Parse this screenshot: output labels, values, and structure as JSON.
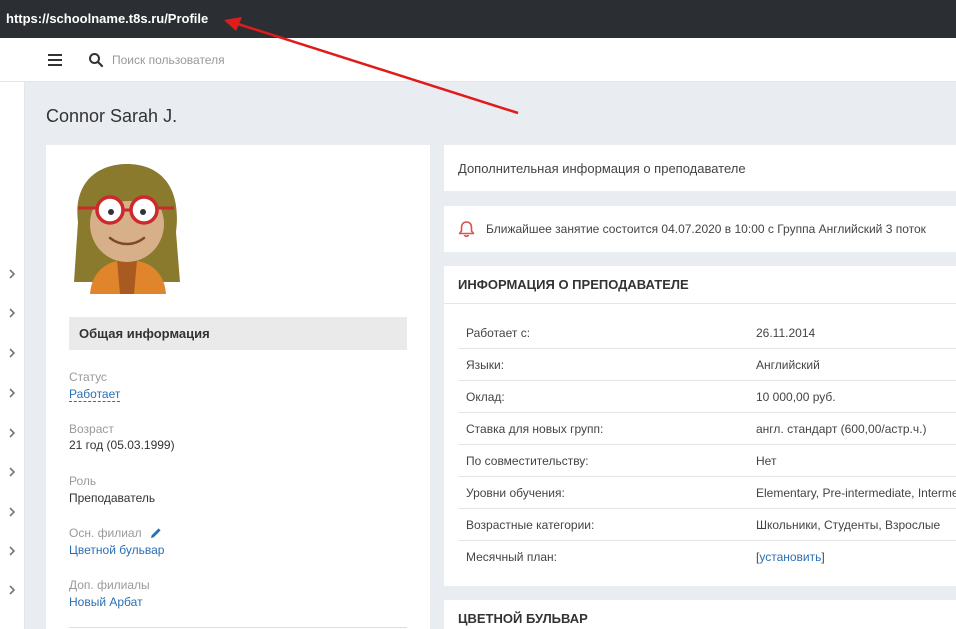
{
  "browser": {
    "url": "https://schoolname.t8s.ru/Profile"
  },
  "topbar": {
    "search_placeholder": "Поиск пользователя"
  },
  "sidebar": {
    "items": 9
  },
  "page": {
    "title": "Connor Sarah J."
  },
  "profile": {
    "section_title": "Общая информация",
    "fields": {
      "status_label": "Статус",
      "status_value": "Работает",
      "age_label": "Возраст",
      "age_value": "21 год (05.03.1999)",
      "role_label": "Роль",
      "role_value": "Преподаватель",
      "branch_label": "Осн. филиал",
      "branch_value": "Цветной бульвар",
      "extra_branches_label": "Доп. филиалы",
      "extra_branches_value": "Новый Арбат"
    }
  },
  "extra_info": {
    "label": "Дополнительная информация о преподавателе"
  },
  "notice": {
    "text": "Ближайшее занятие состоится 04.07.2020 в 10:00 с Группа Английский 3 поток"
  },
  "teacher_info": {
    "title": "ИНФОРМАЦИЯ О ПРЕПОДАВАТЕЛЕ",
    "rows": [
      {
        "key": "Работает с:",
        "value": "26.11.2014"
      },
      {
        "key": "Языки:",
        "value": "Английский"
      },
      {
        "key": "Оклад:",
        "value": "10 000,00 руб."
      },
      {
        "key": "Ставка для новых групп:",
        "value": "англ. стандарт (600,00/астр.ч.)"
      },
      {
        "key": "По совместительству:",
        "value": "Нет"
      },
      {
        "key": "Уровни обучения:",
        "value": "Elementary, Pre-intermediate, Intermediate"
      },
      {
        "key": "Возрастные категории:",
        "value": "Школьники, Студенты, Взрослые"
      },
      {
        "key": "Месячный план:",
        "value_prefix": "[",
        "value_link": "установить",
        "value_suffix": "]"
      }
    ]
  },
  "branch_section": {
    "title": "ЦВЕТНОЙ БУЛЬВАР"
  },
  "colors": {
    "accent": "#2a6fb5",
    "annotation_arrow": "#e01b1b",
    "bell": "#d9534f"
  }
}
